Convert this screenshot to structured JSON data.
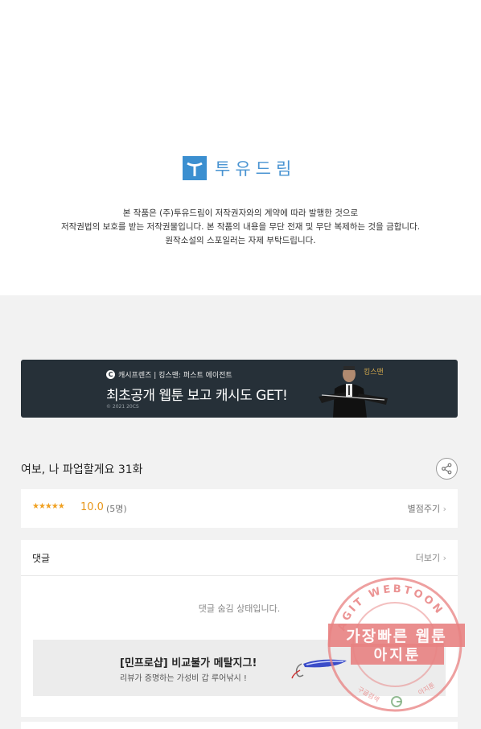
{
  "publisher": {
    "logo_text": "투유드림",
    "notice_lines": [
      "본 작품은 (주)투유드림이 저작권자와의 계약에 따라 발행한 것으로",
      "저작권법의 보호를 받는 저작권물입니다. 본 작품의 내용을 무단 전재 및 무단 복제하는 것을 금합니다.",
      "원작소설의 스포일러는 자제 부탁드립니다."
    ]
  },
  "banner": {
    "brand": "캐시프렌즈 | 킹스맨: 퍼스트 에이전트",
    "headline": "최초공개 웹툰 보고 캐시도 GET!",
    "copyright": "© 2021 20CS",
    "movie_logo": "킹스맨"
  },
  "episode": {
    "title": "여보, 나 파업할게요 31화",
    "share_icon": "share-icon"
  },
  "rating": {
    "stars": "★★★★★",
    "score": "10.0",
    "count": "(5명)",
    "rate_link": "별점주기"
  },
  "comments": {
    "title": "댓글",
    "more_link": "더보기",
    "hidden_message": "댓글 숨김 상태입니다.",
    "ad": {
      "title": "[민프로샵] 비교불가 메탈지그!",
      "subtitle": "리뷰가 증명하는 가성비 갑 루어낚시 !"
    }
  },
  "watermark": {
    "ring_text": "AGIT WEBTOON",
    "line1": "가장빠른 웹툰",
    "line2": "아지툰",
    "left_text": "구글검색",
    "right_text": "아지툰"
  },
  "colors": {
    "brand_blue": "#3b8fd0",
    "banner_bg": "#263038",
    "star": "#f0a020",
    "watermark": "#e88080"
  }
}
